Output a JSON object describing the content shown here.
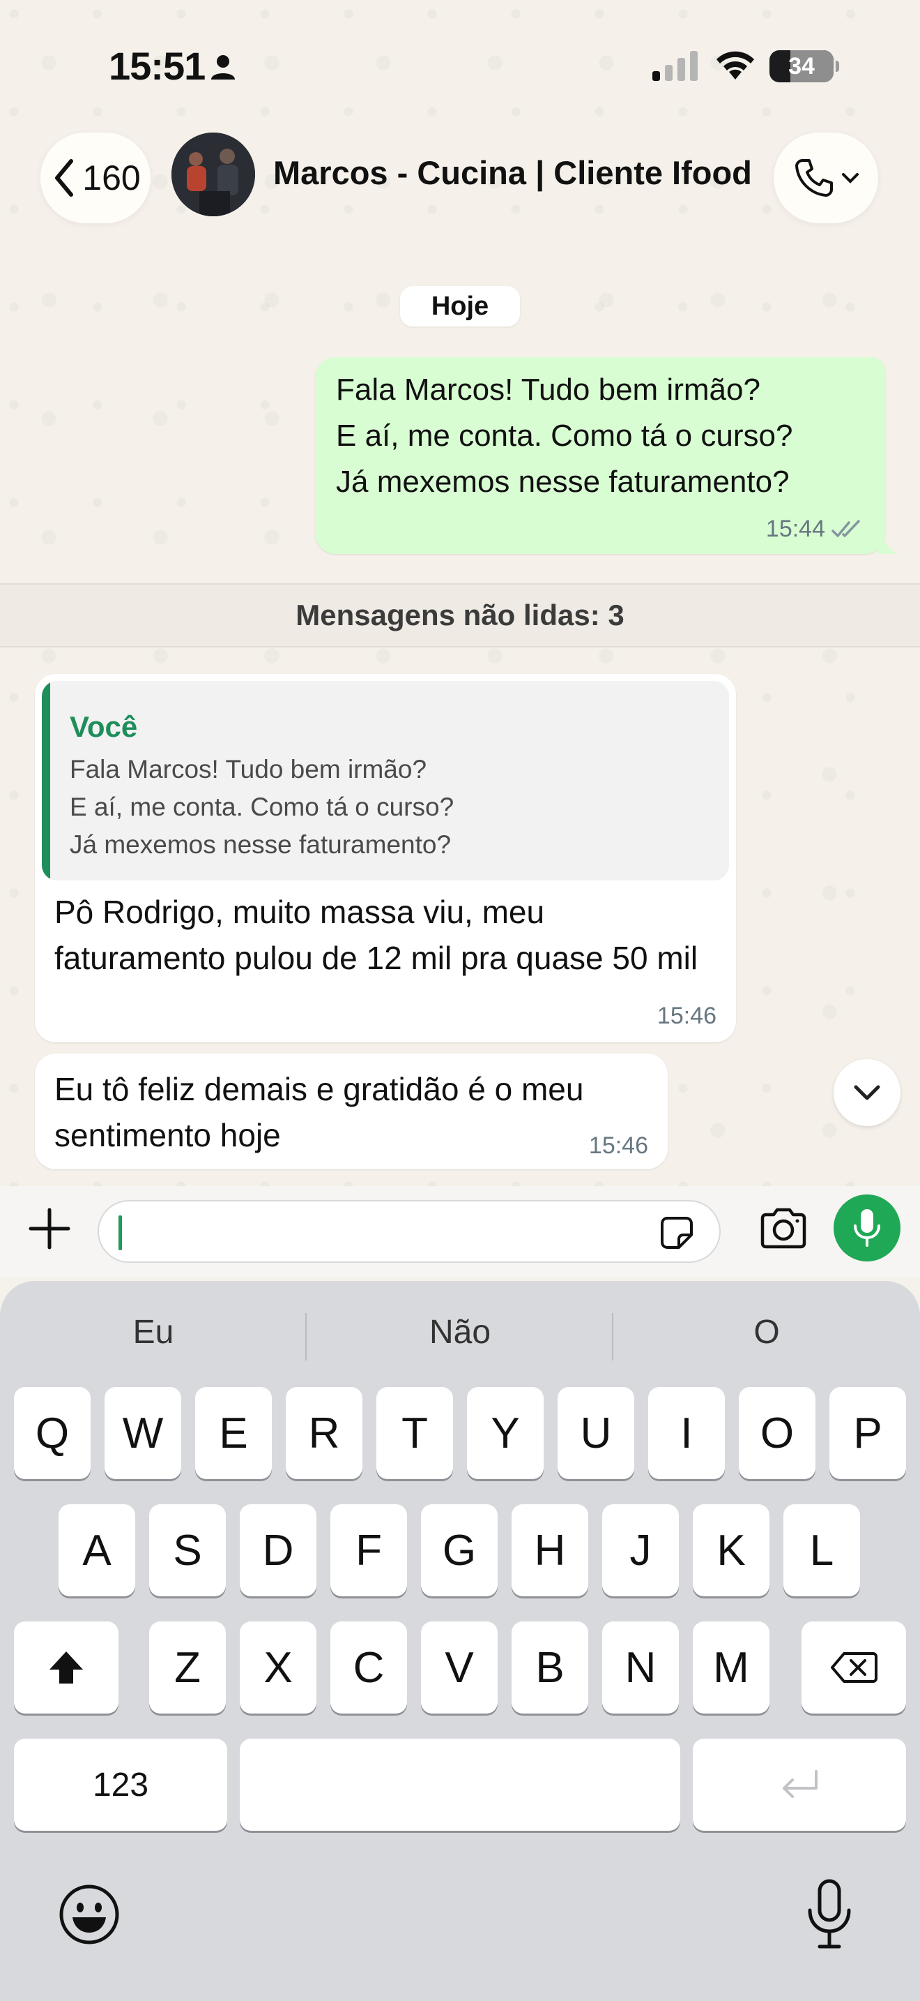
{
  "status_bar": {
    "time": "15:51",
    "battery": "34"
  },
  "header": {
    "back_count": "160",
    "contact_name": "Marcos - Cucina | Cliente Ifood"
  },
  "chat": {
    "date_chip": "Hoje",
    "outgoing": {
      "lines": [
        "Fala Marcos! Tudo bem irmão?",
        "E aí, me conta. Como tá o curso?",
        "Já mexemos nesse faturamento?"
      ],
      "time": "15:44"
    },
    "unread_label": "Mensagens não lidas: 3",
    "incoming_1": {
      "quote_author": "Você",
      "quote_lines": [
        "Fala Marcos! Tudo bem irmão?",
        "E aí, me conta. Como tá o curso?",
        "Já mexemos nesse faturamento?"
      ],
      "text": "Pô Rodrigo, muito massa viu, meu faturamento pulou de 12 mil pra quase 50 mil",
      "time": "15:46"
    },
    "incoming_2": {
      "text": "Eu tô feliz demais e gratidão é o meu sentimento hoje",
      "time": "15:46"
    }
  },
  "input": {
    "value": ""
  },
  "keyboard": {
    "suggestions": [
      "Eu",
      "Não",
      "O"
    ],
    "row1": [
      "Q",
      "W",
      "E",
      "R",
      "T",
      "Y",
      "U",
      "I",
      "O",
      "P"
    ],
    "row2": [
      "A",
      "S",
      "D",
      "F",
      "G",
      "H",
      "J",
      "K",
      "L"
    ],
    "row3": [
      "Z",
      "X",
      "C",
      "V",
      "B",
      "N",
      "M"
    ],
    "numbers_key": "123"
  },
  "colors": {
    "accent_green": "#1fa855",
    "outgoing_bubble": "#d8fdd2",
    "quote_bar": "#1e8e5a"
  },
  "icons": {
    "back": "chevron-left-icon",
    "call": "phone-icon",
    "sent_status": "double-check-icon",
    "scroll": "chevron-down-icon",
    "attach": "plus-icon",
    "sticker": "sticker-icon",
    "camera": "camera-icon",
    "voice": "microphone-icon",
    "emoji": "emoji-icon"
  }
}
